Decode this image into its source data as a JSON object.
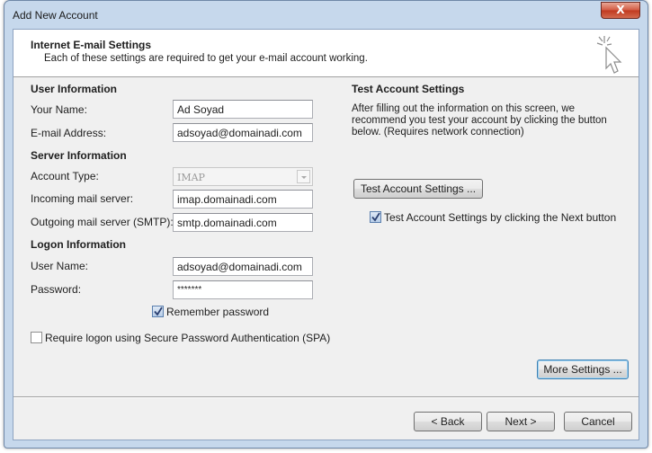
{
  "window": {
    "title": "Add New Account",
    "close_label": "X"
  },
  "header": {
    "title": "Internet E-mail Settings",
    "subtitle": "Each of these settings are required to get your e-mail account working."
  },
  "user_info": {
    "section": "User Information",
    "name_label": "Your Name:",
    "name_value": "Ad Soyad",
    "email_label": "E-mail Address:",
    "email_value": "adsoyad@domainadi.com"
  },
  "server_info": {
    "section": "Server Information",
    "type_label": "Account Type:",
    "type_value": "IMAP",
    "incoming_label": "Incoming mail server:",
    "incoming_value": "imap.domainadi.com",
    "outgoing_label": "Outgoing mail server (SMTP):",
    "outgoing_value": "smtp.domainadi.com"
  },
  "logon_info": {
    "section": "Logon Information",
    "user_label": "User Name:",
    "user_value": "adsoyad@domainadi.com",
    "password_label": "Password:",
    "password_value": "*******",
    "remember_label": "Remember password",
    "remember_checked": true,
    "spa_label": "Require logon using Secure Password Authentication (SPA)",
    "spa_checked": false
  },
  "test": {
    "section": "Test Account Settings",
    "description_line1": "After filling out the information on this screen, we",
    "description_line2": "recommend you test your account by clicking the button",
    "description_line3": "below. (Requires network connection)",
    "button": "Test Account Settings ...",
    "next_check_label": "Test Account Settings by clicking the Next button",
    "next_check_checked": true
  },
  "buttons": {
    "more_settings": "More Settings ...",
    "back": "< Back",
    "next": "Next >",
    "cancel": "Cancel"
  },
  "icons": {
    "header_icon": "cursor-sparkle-icon",
    "check_icon": "checkmark-icon"
  }
}
